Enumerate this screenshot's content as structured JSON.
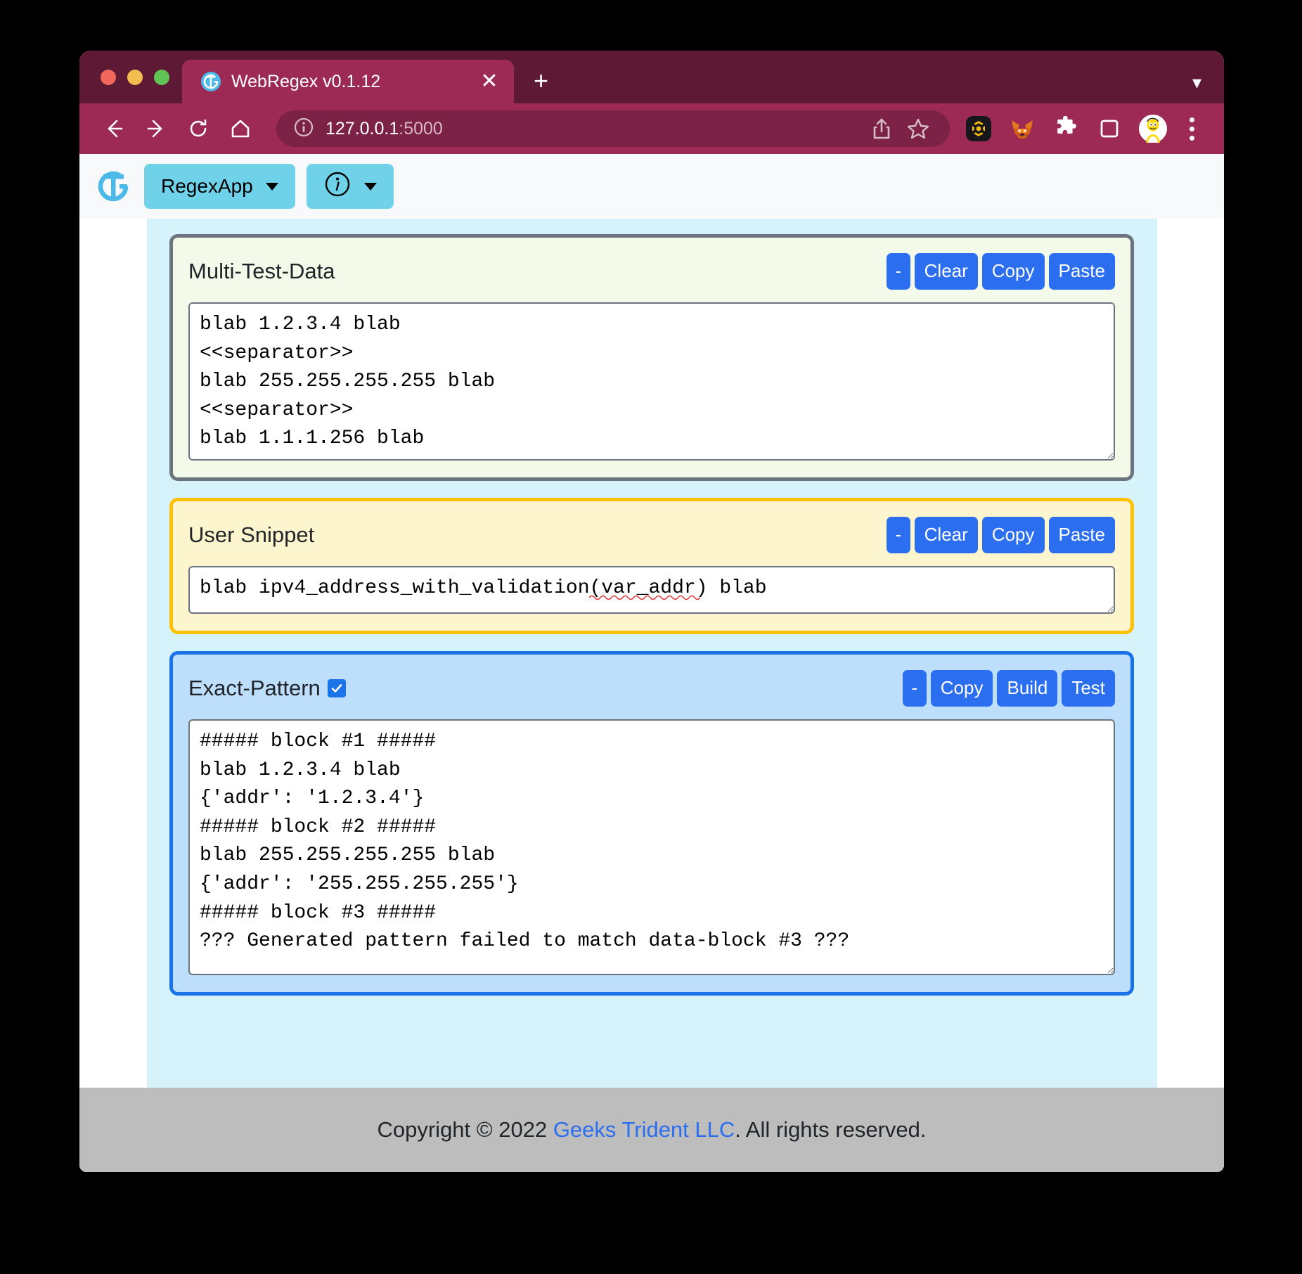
{
  "browser": {
    "tab": {
      "title": "WebRegex v0.1.12",
      "favicon_icon": "gt-logo-icon",
      "close_icon": "close-icon"
    },
    "new_tab_icon": "plus-icon",
    "tab_list_chevron_icon": "chevron-down-icon",
    "nav": {
      "back_icon": "back-arrow-icon",
      "forward_icon": "forward-arrow-icon",
      "reload_icon": "reload-icon",
      "home_icon": "home-icon"
    },
    "omnibox": {
      "info_icon": "info-circle-icon",
      "url_host": "127.0.0.1",
      "url_port": ":5000",
      "share_icon": "share-icon",
      "bookmark_icon": "star-icon"
    },
    "extensions": [
      {
        "name": "bnb-chain-extension-icon"
      },
      {
        "name": "metamask-fox-icon"
      },
      {
        "name": "puzzle-extensions-icon"
      },
      {
        "name": "side-panel-icon"
      },
      {
        "name": "profile-avatar-icon"
      }
    ],
    "menu_icon": "three-dot-menu-icon"
  },
  "app": {
    "navbar": {
      "logo_icon": "gt-brand-logo-icon",
      "app_menu_label": "RegexApp",
      "info_menu_icon": "info-circle-icon",
      "caret_icon": "caret-down-icon"
    },
    "panels": [
      {
        "id": "multi-test-data",
        "title": "Multi-Test-Data",
        "buttons": [
          "-",
          "Clear",
          "Copy",
          "Paste"
        ],
        "textarea_value": "blab 1.2.3.4 blab\n<<separator>>\nblab 255.255.255.255 blab\n<<separator>>\nblab 1.1.1.256 blab",
        "border_color": "#6c757d",
        "background_color": "#f3faea"
      },
      {
        "id": "user-snippet",
        "title": "User Snippet",
        "buttons": [
          "-",
          "Clear",
          "Copy",
          "Paste"
        ],
        "textarea_value": "blab ipv4_address_with_validation(var_addr) blab",
        "spellcheck_word": "var_addr",
        "border_color": "#ffc107",
        "background_color": "#fdf5cd"
      },
      {
        "id": "exact-pattern",
        "title": "Exact-Pattern",
        "checkbox_checked": true,
        "buttons": [
          "-",
          "Copy",
          "Build",
          "Test"
        ],
        "textarea_value": "##### block #1 #####\nblab 1.2.3.4 blab\n{'addr': '1.2.3.4'}\n##### block #2 #####\nblab 255.255.255.255 blab\n{'addr': '255.255.255.255'}\n##### block #3 #####\n??? Generated pattern failed to match data-block #3 ???",
        "border_color": "#1a73e8",
        "background_color": "#bedffc"
      }
    ],
    "footer": {
      "prefix": "Copyright © 2022 ",
      "link": "Geeks Trident LLC",
      "suffix": ". All rights reserved."
    }
  },
  "colors": {
    "browser_chrome": "#9c2a55",
    "browser_chrome_dark": "#5e1934",
    "accent_blue": "#2b6ef0",
    "navbar_btn": "#6fd2e8",
    "content_band": "#d6f2fa",
    "footer_bg": "#bdbdbd"
  }
}
